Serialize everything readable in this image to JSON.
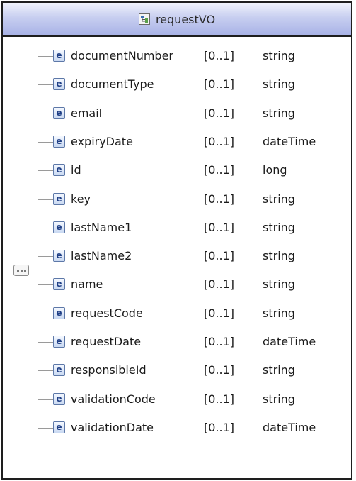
{
  "complex_type": {
    "title": "requestVO",
    "icon": "complex-type-icon"
  },
  "collapse_control": {
    "icon": "sequence-collapse-icon"
  },
  "elements": [
    {
      "icon_letter": "e",
      "name": "documentNumber",
      "multiplicity": "[0..1]",
      "type": "string"
    },
    {
      "icon_letter": "e",
      "name": "documentType",
      "multiplicity": "[0..1]",
      "type": "string"
    },
    {
      "icon_letter": "e",
      "name": "email",
      "multiplicity": "[0..1]",
      "type": "string"
    },
    {
      "icon_letter": "e",
      "name": "expiryDate",
      "multiplicity": "[0..1]",
      "type": "dateTime"
    },
    {
      "icon_letter": "e",
      "name": "id",
      "multiplicity": "[0..1]",
      "type": "long"
    },
    {
      "icon_letter": "e",
      "name": "key",
      "multiplicity": "[0..1]",
      "type": "string"
    },
    {
      "icon_letter": "e",
      "name": "lastName1",
      "multiplicity": "[0..1]",
      "type": "string"
    },
    {
      "icon_letter": "e",
      "name": "lastName2",
      "multiplicity": "[0..1]",
      "type": "string"
    },
    {
      "icon_letter": "e",
      "name": "name",
      "multiplicity": "[0..1]",
      "type": "string"
    },
    {
      "icon_letter": "e",
      "name": "requestCode",
      "multiplicity": "[0..1]",
      "type": "string"
    },
    {
      "icon_letter": "e",
      "name": "requestDate",
      "multiplicity": "[0..1]",
      "type": "dateTime"
    },
    {
      "icon_letter": "e",
      "name": "responsibleId",
      "multiplicity": "[0..1]",
      "type": "string"
    },
    {
      "icon_letter": "e",
      "name": "validationCode",
      "multiplicity": "[0..1]",
      "type": "string"
    },
    {
      "icon_letter": "e",
      "name": "validationDate",
      "multiplicity": "[0..1]",
      "type": "dateTime"
    }
  ]
}
